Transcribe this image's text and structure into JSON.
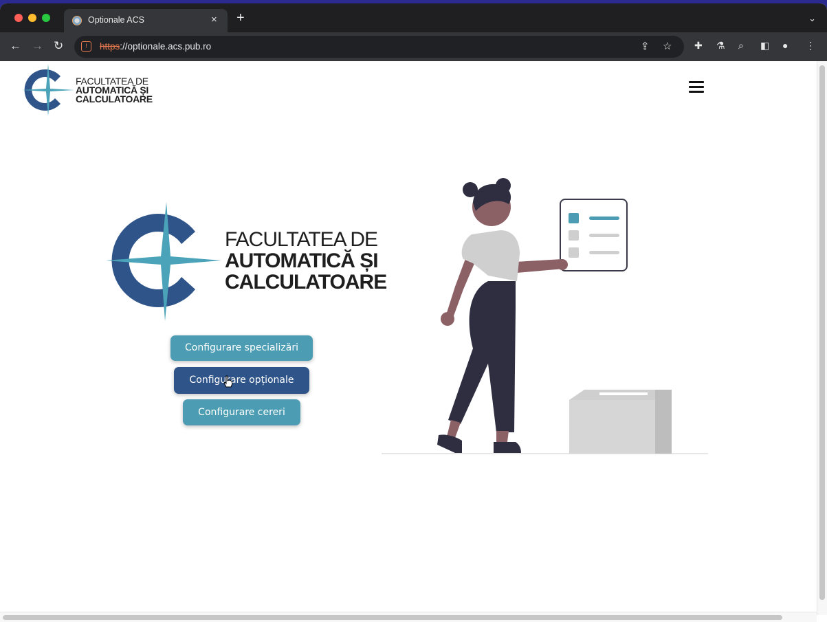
{
  "browser": {
    "tab_title": "Optionale ACS",
    "new_tab_glyph": "+",
    "tab_close_glyph": "×",
    "tab_menu_glyph": "⌄",
    "url_scheme": "https",
    "url_rest": "://optionale.acs.pub.ro",
    "nav_back": "←",
    "nav_forward": "→",
    "nav_reload": "↻",
    "lock_glyph": "!",
    "share_glyph": "⇪",
    "star_glyph": "☆",
    "extensions_glyph": "✚",
    "labs_glyph": "⚗",
    "search_glyph": "⌕",
    "sidepanel_glyph": "◧",
    "profile_glyph": "●",
    "menu_glyph": "⋮"
  },
  "header": {
    "logo_line1": "FACULTATEA DE",
    "logo_line2": "AUTOMATICĂ ȘI",
    "logo_line3": "CALCULATOARE"
  },
  "hero": {
    "logo_line1": "FACULTATEA DE",
    "logo_line2": "AUTOMATICĂ ȘI",
    "logo_line3": "CALCULATOARE"
  },
  "buttons": {
    "specializari": "Configurare specializări",
    "optionale": "Configurare opționale",
    "cereri": "Configurare cereri"
  },
  "colors": {
    "teal": "#4c9db3",
    "navy": "#2f5489",
    "logo_blue": "#2f5489",
    "logo_teal": "#4aa3b9"
  }
}
